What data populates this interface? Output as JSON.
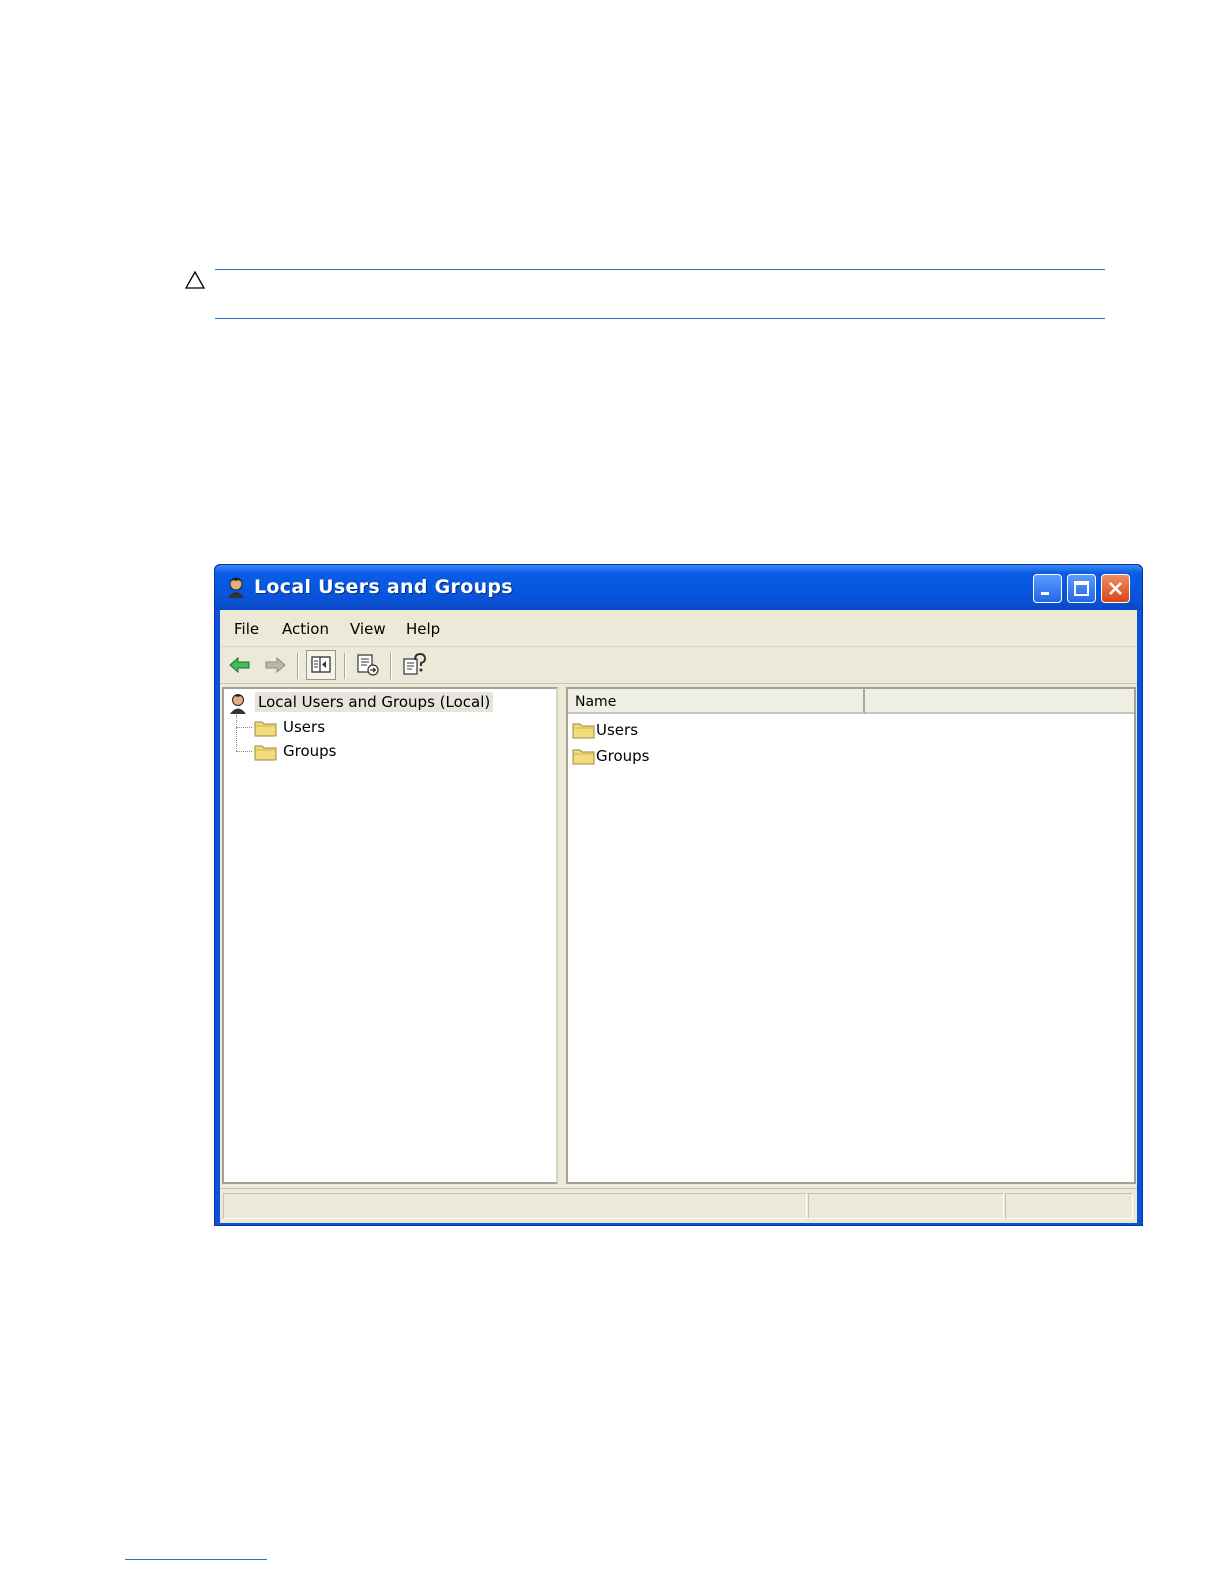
{
  "caution": {
    "icon": "warning-triangle-icon"
  },
  "window": {
    "title": "Local Users and Groups",
    "title_icon": "users-snapin-icon",
    "controls": {
      "minimize": "minimize-icon",
      "maximize": "maximize-icon",
      "close": "close-icon"
    },
    "menu": {
      "file": "File",
      "action": "Action",
      "view": "View",
      "help": "Help"
    },
    "toolbar": [
      "back-arrow-icon",
      "forward-arrow-icon",
      "show-hide-tree-icon",
      "export-list-icon",
      "help-icon"
    ],
    "tree": {
      "root": "Local Users and Groups (Local)",
      "children": [
        "Users",
        "Groups"
      ]
    },
    "list": {
      "columns": [
        "Name",
        ""
      ],
      "items": [
        "Users",
        "Groups"
      ]
    },
    "colors": {
      "title_blue": "#0a5ce4",
      "chrome": "#ece9d8",
      "rule_blue": "#2a73c9"
    }
  }
}
